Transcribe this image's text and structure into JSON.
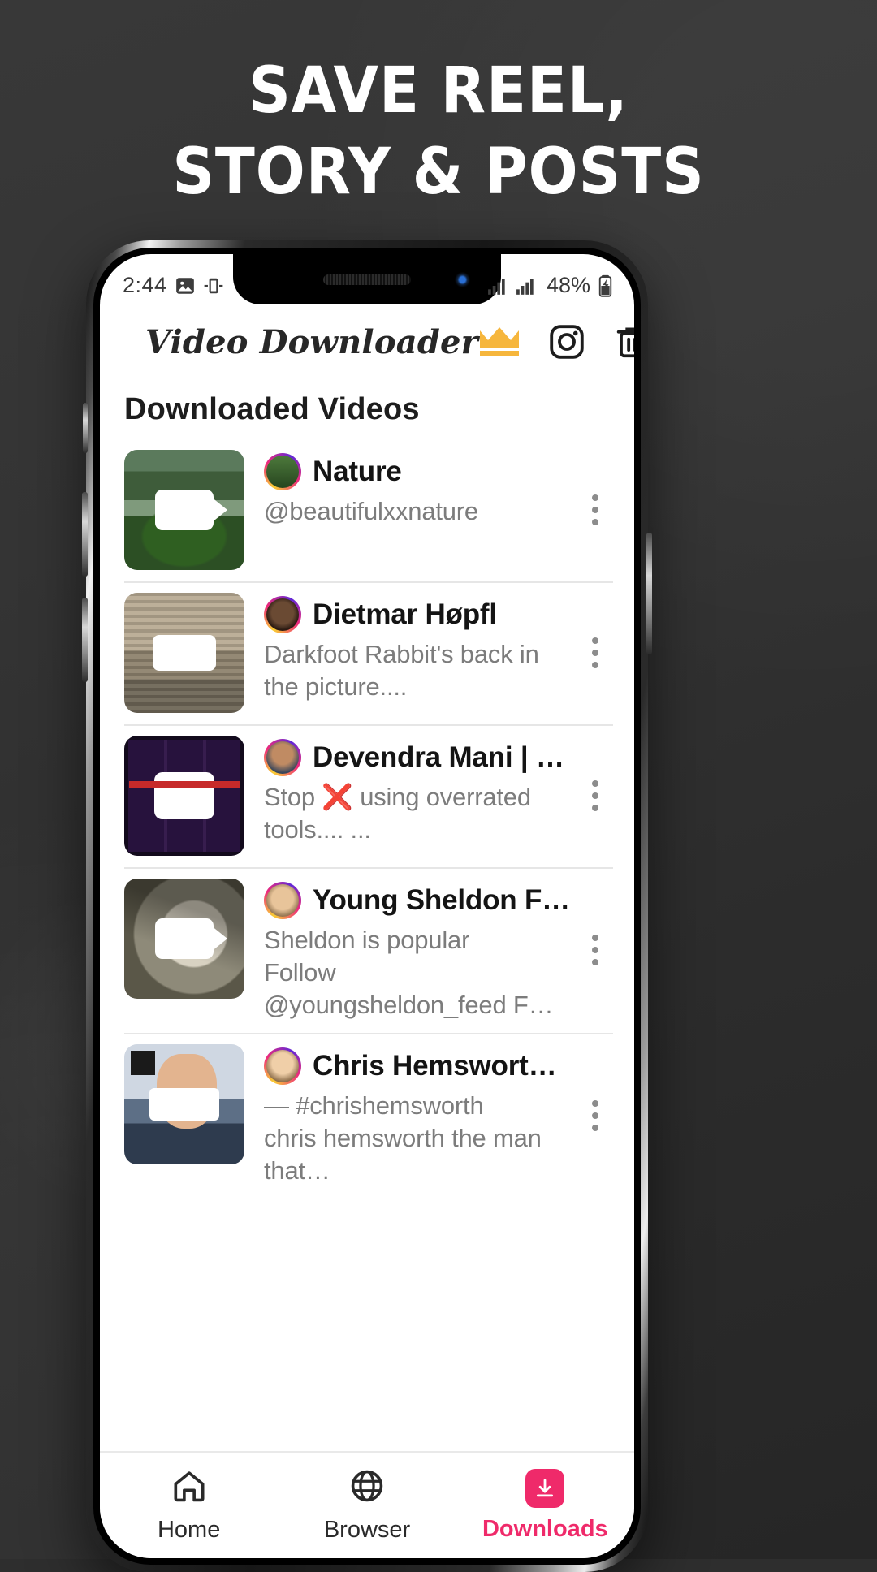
{
  "promo": {
    "headline_line1": "SAVE REEL,",
    "headline_line2": "STORY & POSTS",
    "bg_color": "#2e2e2e",
    "headline_color": "#ffffff"
  },
  "status_bar": {
    "time": "2:44",
    "left_icons": [
      "image-icon",
      "screenshot-icon"
    ],
    "signal_icons": [
      "signal-bars-icon",
      "signal-bars-icon"
    ],
    "battery_percent": "48%",
    "battery_icon": "battery-charging-icon"
  },
  "appbar": {
    "menu_icon": "hamburger-menu-icon",
    "title": "Video Downloader",
    "actions": [
      {
        "name": "premium-crown-button",
        "icon": "crown-icon",
        "color": "#f6b63c"
      },
      {
        "name": "instagram-button",
        "icon": "instagram-icon",
        "color": "#1c1c1c"
      },
      {
        "name": "delete-all-button",
        "icon": "trash-icon",
        "color": "#1c1c1c"
      }
    ]
  },
  "main": {
    "section_title": "Downloaded Videos",
    "items": [
      {
        "thumb_class": "t-nature",
        "play_class": "play",
        "avatar_class": "av-nature",
        "name": "Nature",
        "desc": "@beautifulxxnature"
      },
      {
        "thumb_class": "t-rabbit",
        "play_class": "play flat",
        "avatar_class": "av-monkey",
        "name": "Dietmar Høpfl",
        "desc": "Darkfoot Rabbit's back in the picture...."
      },
      {
        "thumb_class": "t-dark",
        "play_class": "play cup",
        "avatar_class": "av-dev",
        "name": "Devendra Mani | Soci…",
        "desc": "Stop ❌ using overrated tools.... ..."
      },
      {
        "thumb_class": "t-clock",
        "play_class": "play",
        "avatar_class": "av-sheldon",
        "name": "Young Sheldon Feed",
        "desc": "Sheldon is popular\nFollow @youngsheldon_feed F…"
      },
      {
        "thumb_class": "t-face",
        "play_class": "play bar",
        "avatar_class": "av-chris",
        "name": "Chris Hemsworth Fan-…",
        "desc": "— #chrishemsworth\nchris hemsworth the man that…"
      }
    ]
  },
  "bottom_nav": {
    "items": [
      {
        "label": "Home",
        "icon": "home-icon",
        "active": false
      },
      {
        "label": "Browser",
        "icon": "globe-icon",
        "active": false
      },
      {
        "label": "Downloads",
        "icon": "download-icon",
        "active": true
      }
    ],
    "active_color": "#ef2a6a"
  }
}
